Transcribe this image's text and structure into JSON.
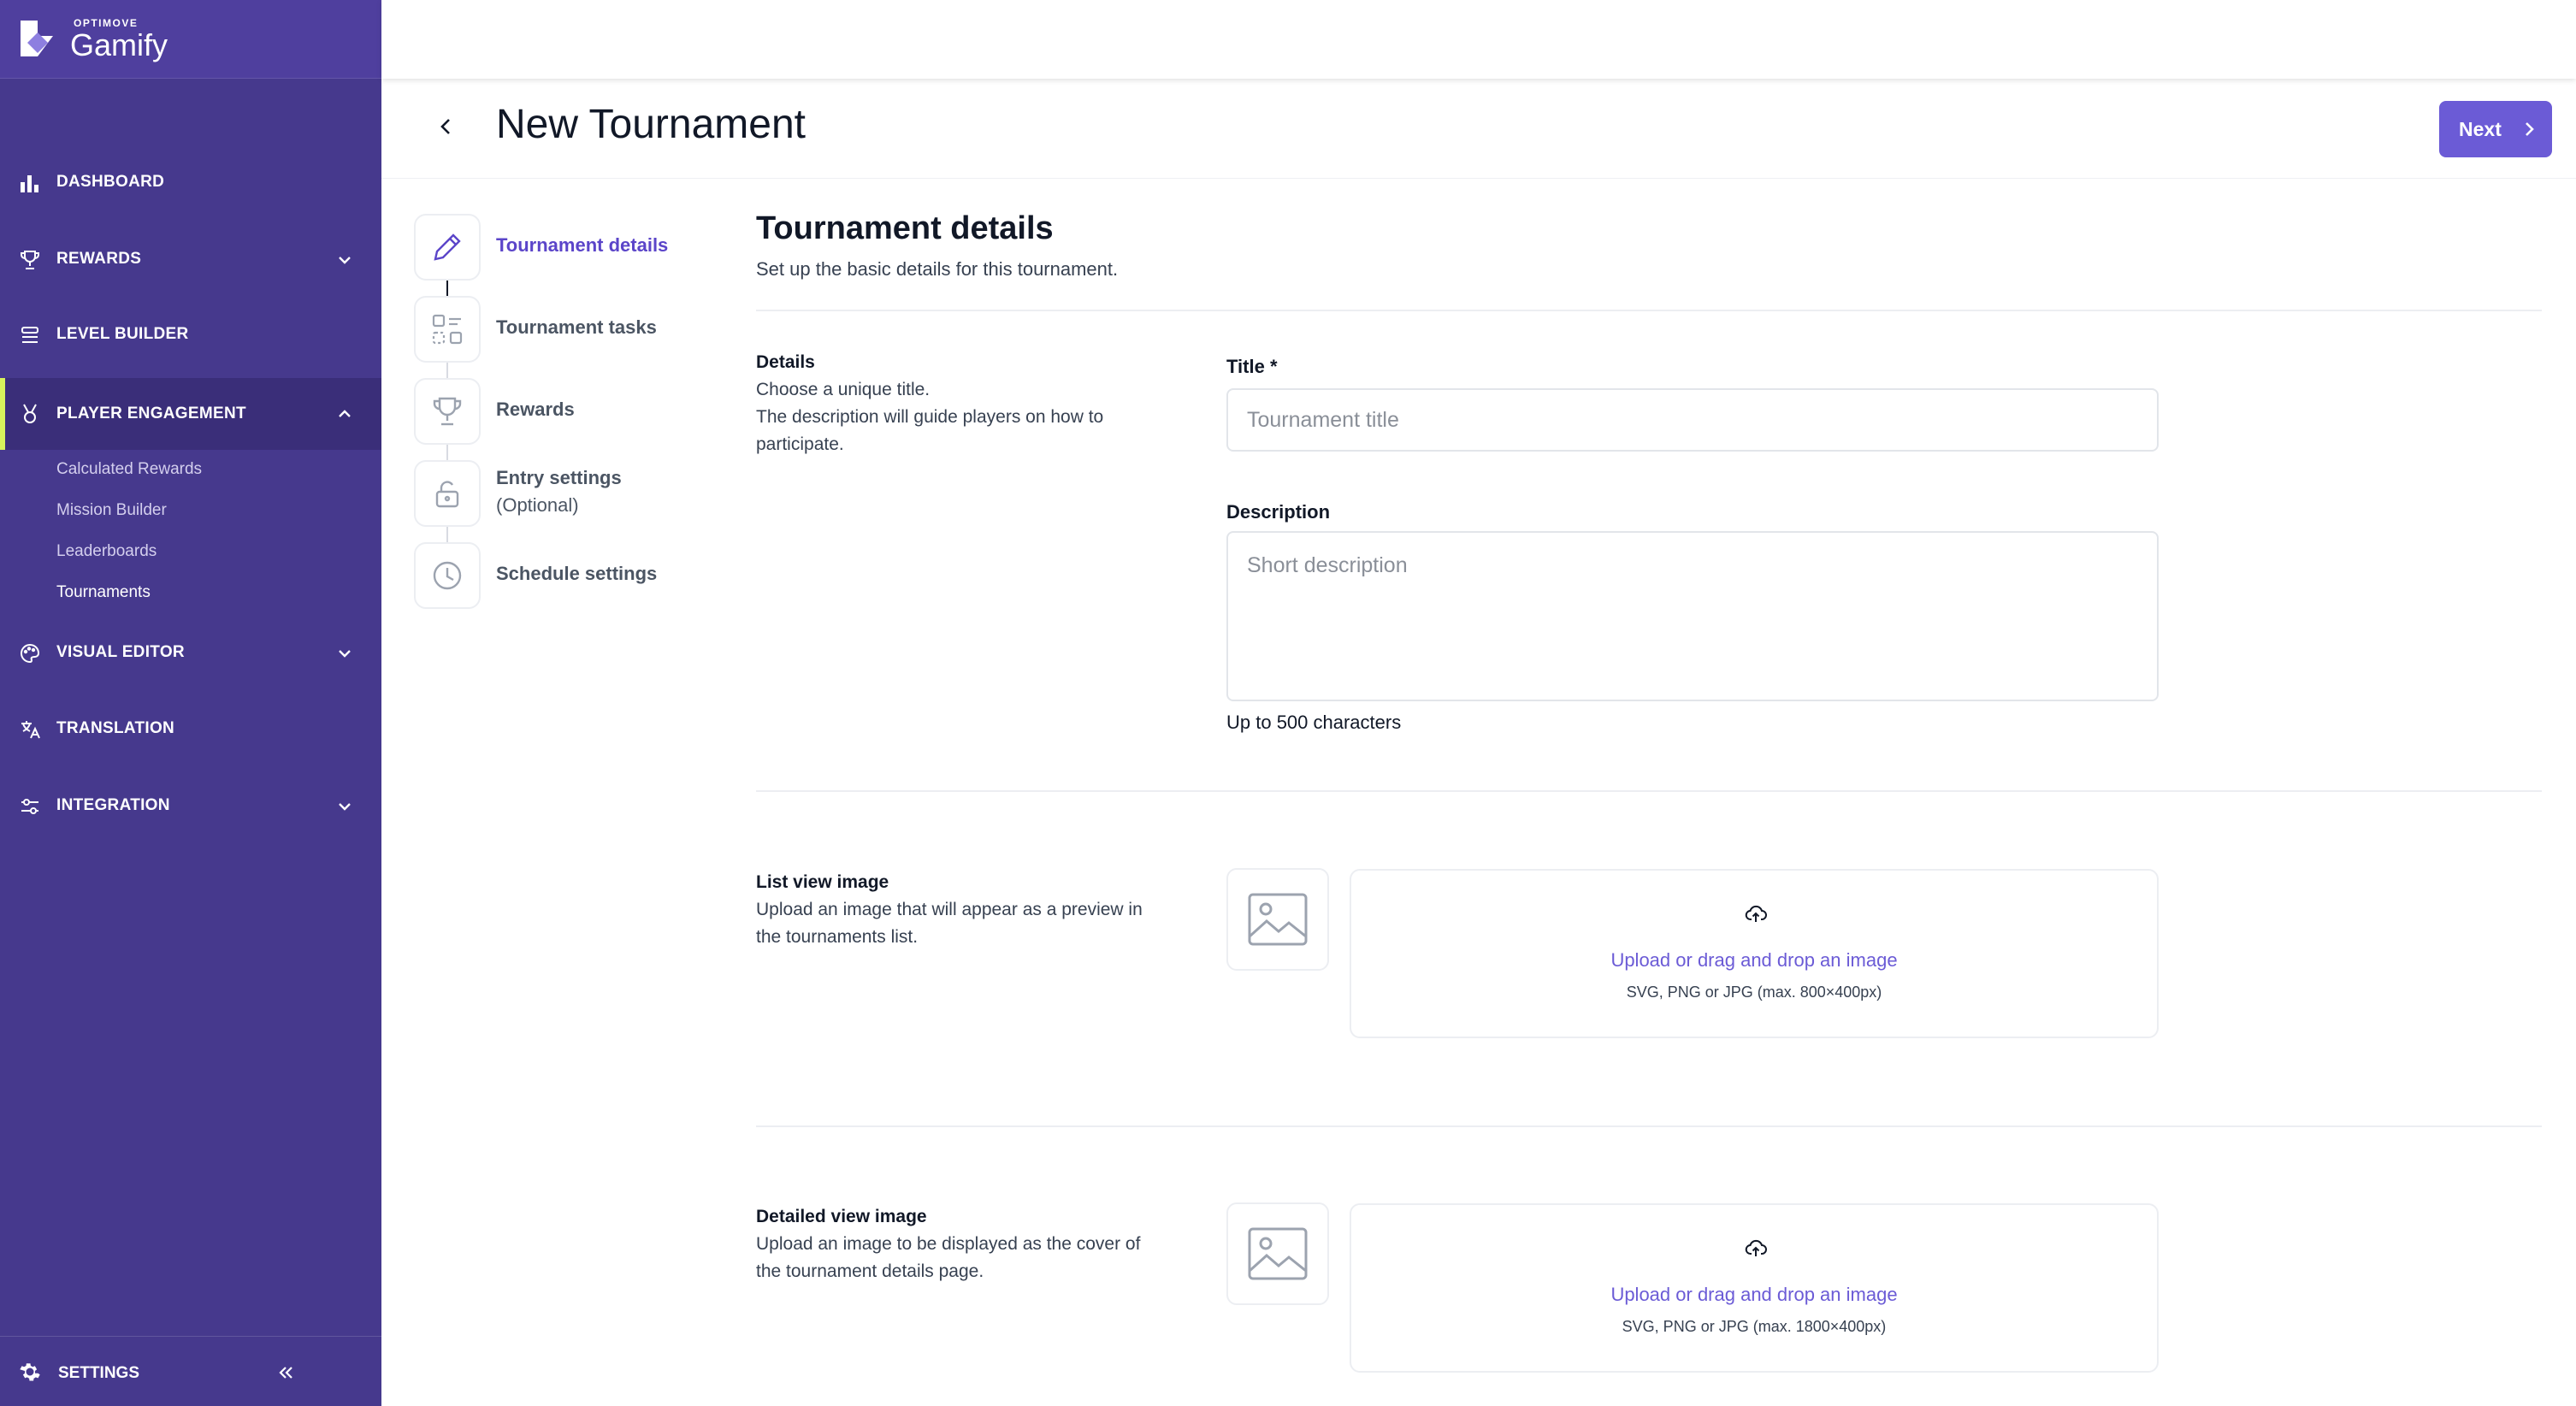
{
  "brand": {
    "company": "OPTIMOVE",
    "product": "Gamify"
  },
  "sidebar": {
    "nav": [
      {
        "label": "DASHBOARD",
        "icon": "bar-chart-icon"
      },
      {
        "label": "REWARDS",
        "icon": "trophy-icon",
        "expandable": true
      },
      {
        "label": "LEVEL BUILDER",
        "icon": "layers-icon"
      },
      {
        "label": "PLAYER ENGAGEMENT",
        "icon": "medal-icon",
        "expandable": true,
        "expanded": true,
        "active": true
      },
      {
        "label": "VISUAL EDITOR",
        "icon": "palette-icon",
        "expandable": true
      },
      {
        "label": "TRANSLATION",
        "icon": "translate-icon"
      },
      {
        "label": "INTEGRATION",
        "icon": "sliders-icon",
        "expandable": true
      }
    ],
    "sub_items": [
      {
        "label": "Calculated Rewards"
      },
      {
        "label": "Mission Builder"
      },
      {
        "label": "Leaderboards"
      },
      {
        "label": "Tournaments",
        "current": true
      }
    ],
    "footer": {
      "label": "SETTINGS",
      "icon": "gear-icon"
    }
  },
  "header": {
    "title": "New Tournament",
    "next_label": "Next"
  },
  "steps": [
    {
      "label": "Tournament details",
      "icon": "pencil-icon",
      "active": true
    },
    {
      "label": "Tournament tasks",
      "icon": "tasks-icon"
    },
    {
      "label": "Rewards",
      "icon": "trophy-icon"
    },
    {
      "label": "Entry settings",
      "label2": "(Optional)",
      "icon": "unlock-icon"
    },
    {
      "label": "Schedule settings",
      "icon": "clock-icon"
    }
  ],
  "content": {
    "title": "Tournament details",
    "subtitle": "Set up the basic details for this tournament.",
    "details": {
      "title": "Details",
      "desc_line1": "Choose a unique title.",
      "desc_line2": "The description will guide players on how to participate.",
      "title_label": "Title *",
      "title_placeholder": "Tournament title",
      "title_value": "",
      "description_label": "Description",
      "description_placeholder": "Short description",
      "description_value": "",
      "description_hint": "Up to 500 characters"
    },
    "list_image": {
      "title": "List view image",
      "desc": "Upload an image that will appear as a preview in the tournaments list.",
      "upload_text": "Upload or drag and drop an image",
      "formats": "SVG, PNG or JPG (max. 800×400px)"
    },
    "detail_image": {
      "title": "Detailed view image",
      "desc": "Upload an image to be displayed as the cover of the tournament details page.",
      "upload_text": "Upload or drag and drop an image",
      "formats": "SVG, PNG or JPG (max. 1800×400px)"
    }
  },
  "colors": {
    "sidebar_bg": "#46398d",
    "sidebar_active_bg": "#3a2e79",
    "active_indicator": "#d7f25c",
    "accent": "#6b5bd6",
    "active_step_text": "#5b45c9"
  }
}
